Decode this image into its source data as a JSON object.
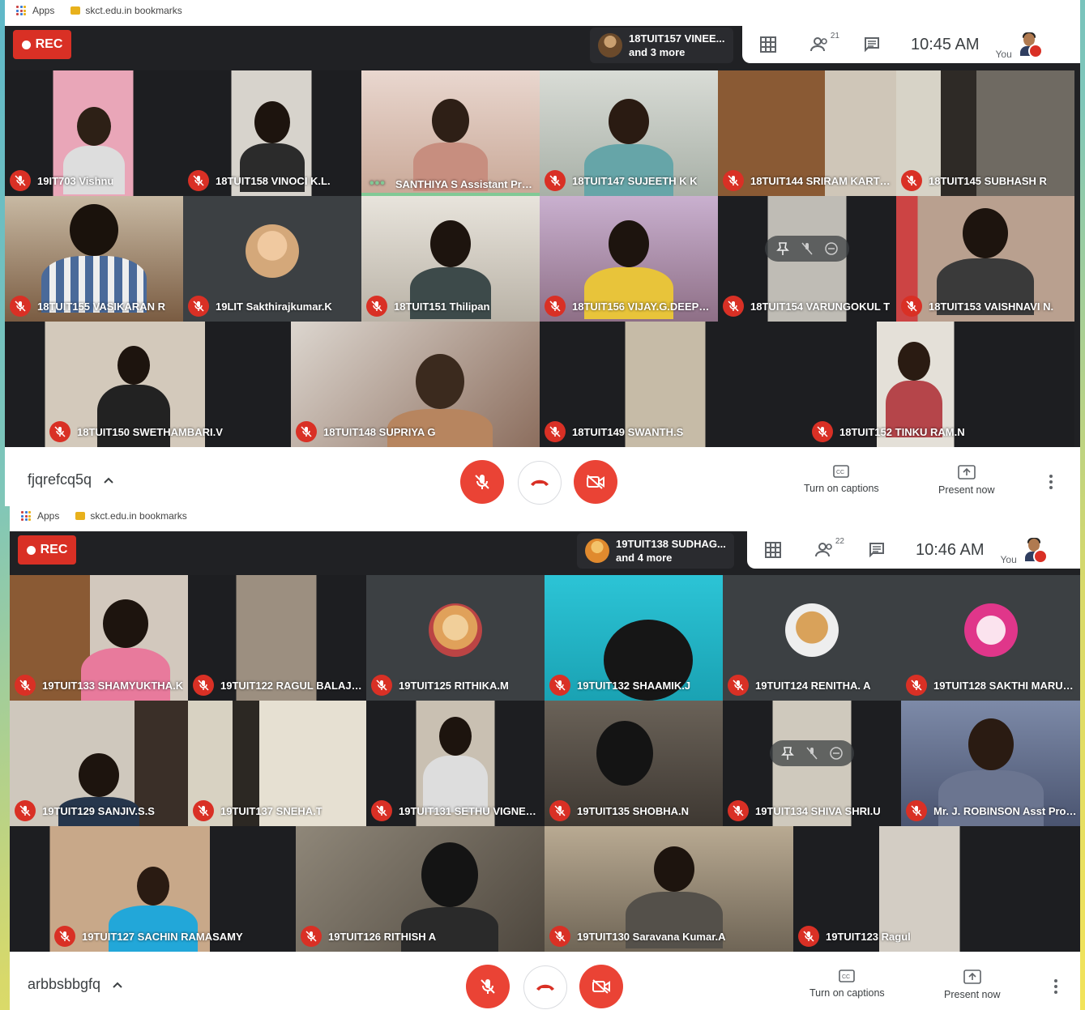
{
  "shots": [
    {
      "bookmarks": {
        "apps": "Apps",
        "folder": "skct.edu.in bookmarks"
      },
      "rec_label": "REC",
      "presenter": {
        "line1": "18TUIT157 VINEE...",
        "line2": "and 3 more"
      },
      "participants_count": "21",
      "time": "10:45 AM",
      "you_label": "You",
      "meeting_code": "fjqrefcq5q",
      "captions_label": "Turn on captions",
      "present_label": "Present now",
      "tiles": [
        {
          "name": "19IT703 Vishnu"
        },
        {
          "name": "18TUIT158 VINOCI K.L."
        },
        {
          "name": "SANTHIYA S Assistant Prof..."
        },
        {
          "name": "18TUIT147 SUJEETH K K"
        },
        {
          "name": "18TUIT144 SRIRAM KARTHI..."
        },
        {
          "name": "18TUIT145 SUBHASH R"
        },
        {
          "name": "18TUIT155 VASIKARAN R"
        },
        {
          "name": "19LIT Sakthirajkumar.K"
        },
        {
          "name": "18TUIT151 Thilipan"
        },
        {
          "name": "18TUIT156 VIJAY.G.DEEPTHI"
        },
        {
          "name": "18TUIT154 VARUNGOKUL T"
        },
        {
          "name": "18TUIT153 VAISHNAVI N."
        },
        {
          "name": "18TUIT150 SWETHAMBARI.V"
        },
        {
          "name": "18TUIT148 SUPRIYA G"
        },
        {
          "name": "18TUIT149 SWANTH.S"
        },
        {
          "name": "18TUIT152 TINKU RAM.N"
        }
      ]
    },
    {
      "bookmarks": {
        "apps": "Apps",
        "folder": "skct.edu.in bookmarks"
      },
      "rec_label": "REC",
      "presenter": {
        "line1": "19TUIT138 SUDHAG...",
        "line2": "and 4 more"
      },
      "participants_count": "22",
      "time": "10:46 AM",
      "you_label": "You",
      "meeting_code": "arbbsbbgfq",
      "captions_label": "Turn on captions",
      "present_label": "Present now",
      "tiles": [
        {
          "name": "19TUIT133 SHAMYUKTHA.K"
        },
        {
          "name": "19TUIT122 RAGUL BALAJI.S"
        },
        {
          "name": "19TUIT125 RITHIKA.M"
        },
        {
          "name": "19TUIT132 SHAAMIK.J"
        },
        {
          "name": "19TUIT124 RENITHA. A"
        },
        {
          "name": "19TUIT128 SAKTHI MARUV..."
        },
        {
          "name": "19TUIT129 SANJIV.S.S"
        },
        {
          "name": "19TUIT137 SNEHA.T"
        },
        {
          "name": "19TUIT131 SETHU VIGNES..."
        },
        {
          "name": "19TUIT135 SHOBHA.N"
        },
        {
          "name": "19TUIT134 SHIVA SHRI.U"
        },
        {
          "name": "Mr. J. ROBINSON Asst Prof ..."
        },
        {
          "name": "19TUIT127 SACHIN RAMASAMY"
        },
        {
          "name": "19TUIT126 RITHISH A"
        },
        {
          "name": "19TUIT130 Saravana Kumar.A"
        },
        {
          "name": "19TUIT123 Ragul"
        }
      ]
    }
  ],
  "colors": {
    "rec": "#d93025",
    "mute": "#d93025",
    "speaking": "#81c995",
    "meet_bg": "#202124"
  }
}
